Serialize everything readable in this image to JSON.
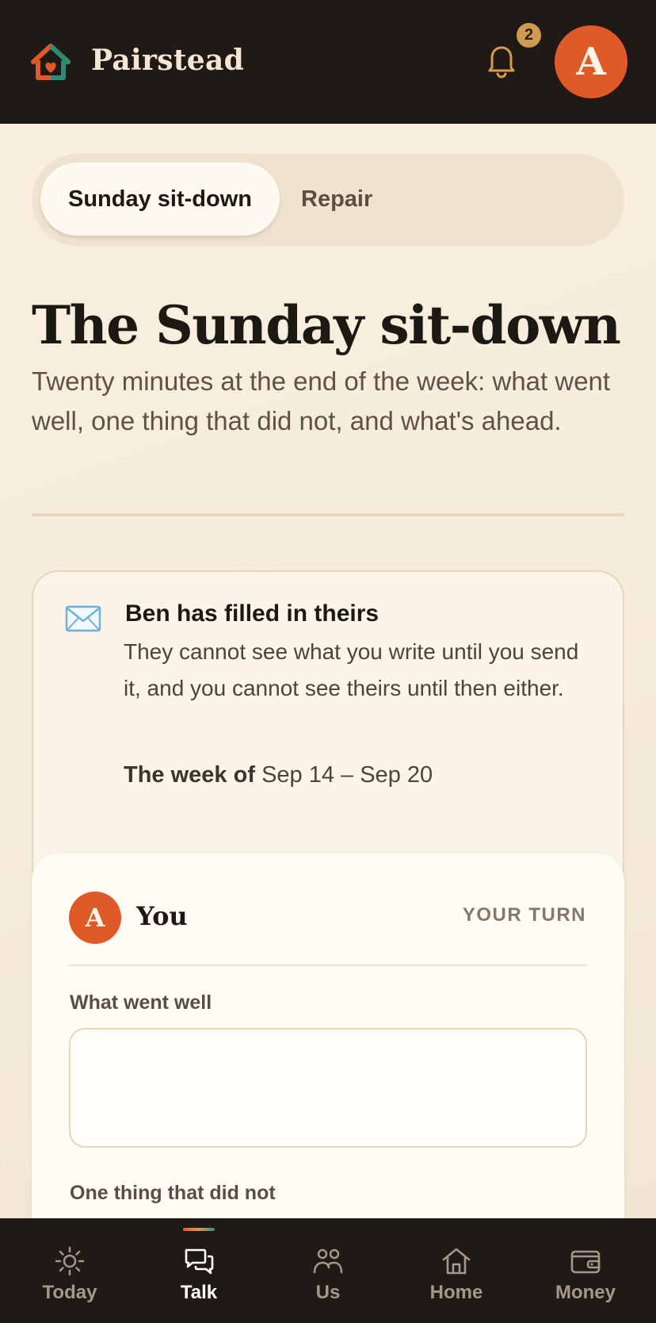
{
  "app": {
    "name": "Pairstead",
    "notification_count": "2",
    "avatar_initial": "A"
  },
  "tabs": [
    {
      "label": "Sunday sit-down",
      "active": true
    },
    {
      "label": "Repair",
      "active": false
    }
  ],
  "header": {
    "title": "The Sunday sit-down",
    "subtitle": "Twenty minutes at the end of the week: what went well, one thing that did not, and what's ahead."
  },
  "notice": {
    "title": "Ben has filled in theirs",
    "body": "They cannot see what you write until you send it, and you cannot see theirs until then either.",
    "week_label": "The week of",
    "week_range": "Sep 14 – Sep 20"
  },
  "entry": {
    "avatar_initial": "A",
    "name": "You",
    "status": "YOUR TURN",
    "fields": [
      {
        "label": "What went well",
        "value": ""
      },
      {
        "label": "One thing that did not",
        "value": ""
      }
    ]
  },
  "nav": [
    {
      "label": "Today",
      "icon": "sun-icon",
      "active": false
    },
    {
      "label": "Talk",
      "icon": "chat-icon",
      "active": true
    },
    {
      "label": "Us",
      "icon": "people-icon",
      "active": false
    },
    {
      "label": "Home",
      "icon": "house-icon",
      "active": false
    },
    {
      "label": "Money",
      "icon": "wallet-icon",
      "active": false
    }
  ],
  "colors": {
    "accent": "#e05a28",
    "dark": "#201a16",
    "badge": "#cf9a52",
    "background": "#f6ecdd"
  }
}
